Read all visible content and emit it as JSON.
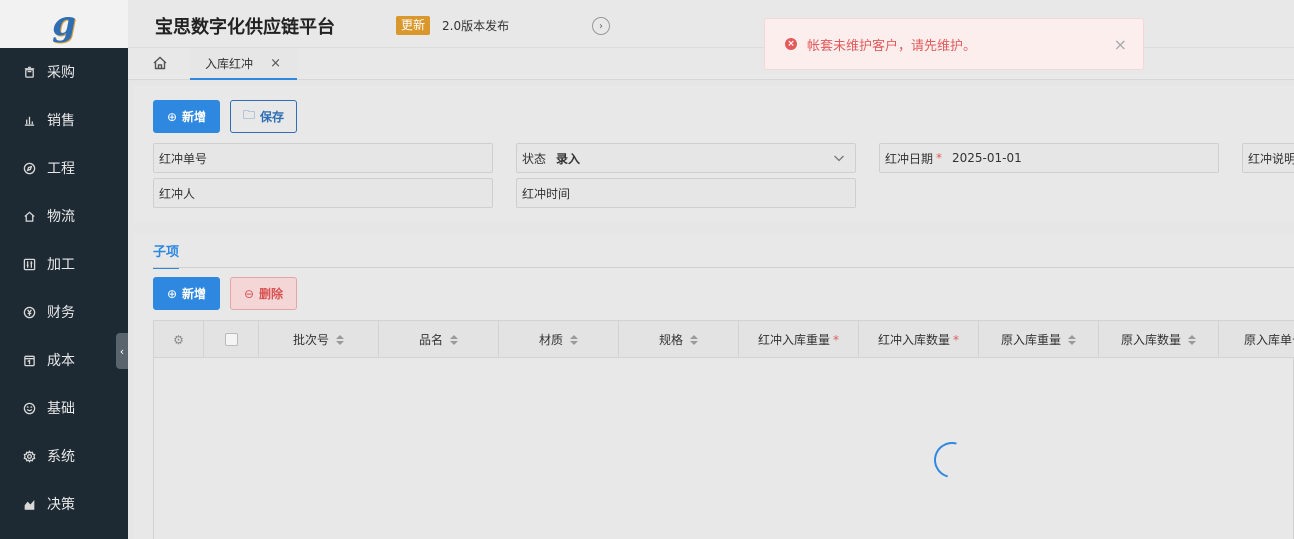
{
  "app": {
    "logo_glyph": "g",
    "title": "宝思数字化供应链平台",
    "update_badge": "更新",
    "update_text": "2.0版本发布"
  },
  "sidebar": {
    "items": [
      {
        "label": "采购",
        "icon": "trash-bin-icon"
      },
      {
        "label": "销售",
        "icon": "bar-chart-icon"
      },
      {
        "label": "工程",
        "icon": "compass-icon"
      },
      {
        "label": "物流",
        "icon": "home-icon"
      },
      {
        "label": "加工",
        "icon": "sliders-icon"
      },
      {
        "label": "财务",
        "icon": "yen-icon"
      },
      {
        "label": "成本",
        "icon": "calendar-icon"
      },
      {
        "label": "基础",
        "icon": "smile-icon"
      },
      {
        "label": "系统",
        "icon": "gear-icon"
      },
      {
        "label": "决策",
        "icon": "area-chart-icon"
      }
    ]
  },
  "tabs": {
    "active_label": "入库红冲",
    "close_glyph": "×"
  },
  "form": {
    "add_label": "新增",
    "save_label": "保存",
    "fields": {
      "red_no_label": "红冲单号",
      "status_label": "状态",
      "status_value": "录入",
      "red_date_label": "红冲日期",
      "red_date_required": "*",
      "red_date_value": "2025-01-01",
      "red_desc_label": "红冲说明",
      "red_person_label": "红冲人",
      "red_time_label": "红冲时间"
    }
  },
  "sub": {
    "tab_label": "子项",
    "add_label": "新增",
    "delete_label": "删除",
    "columns": [
      {
        "label": "批次号",
        "required": "",
        "sortable": true
      },
      {
        "label": "品名",
        "required": "",
        "sortable": true
      },
      {
        "label": "材质",
        "required": "",
        "sortable": true
      },
      {
        "label": "规格",
        "required": "",
        "sortable": true
      },
      {
        "label": "红冲入库重量",
        "required": "*",
        "sortable": false
      },
      {
        "label": "红冲入库数量",
        "required": "*",
        "sortable": false
      },
      {
        "label": "原入库重量",
        "required": "",
        "sortable": true
      },
      {
        "label": "原入库数量",
        "required": "",
        "sortable": true
      },
      {
        "label": "原入库单号",
        "required": "",
        "sortable": false
      }
    ]
  },
  "toast": {
    "message": "帐套未维护客户，请先维护。",
    "close_glyph": "×",
    "error_glyph": "×"
  },
  "colors": {
    "primary": "#2f88e0",
    "sidebar_bg": "#1e2a33",
    "badge": "#d9972c",
    "error": "#e05b5b"
  }
}
